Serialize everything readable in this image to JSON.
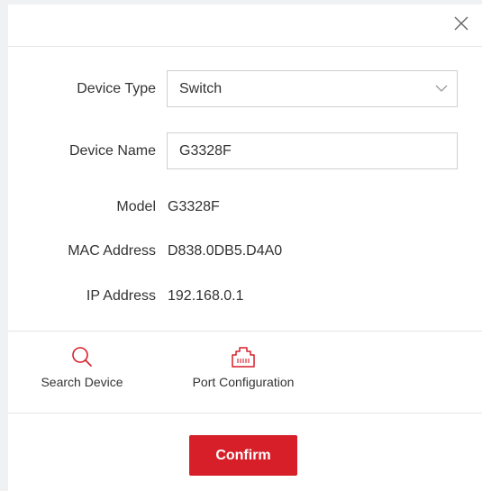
{
  "form": {
    "device_type": {
      "label": "Device Type",
      "value": "Switch"
    },
    "device_name": {
      "label": "Device Name",
      "value": "G3328F"
    },
    "model": {
      "label": "Model",
      "value": "G3328F"
    },
    "mac_address": {
      "label": "MAC Address",
      "value": "D838.0DB5.D4A0"
    },
    "ip_address": {
      "label": "IP Address",
      "value": "192.168.0.1"
    }
  },
  "tools": {
    "search_device": {
      "label": "Search Device",
      "icon": "search-icon",
      "color": "#d71f29"
    },
    "port_configuration": {
      "label": "Port Configuration",
      "icon": "ethernet-port-icon",
      "color": "#d71f29"
    }
  },
  "footer": {
    "confirm_label": "Confirm",
    "confirm_color": "#d71f29"
  }
}
